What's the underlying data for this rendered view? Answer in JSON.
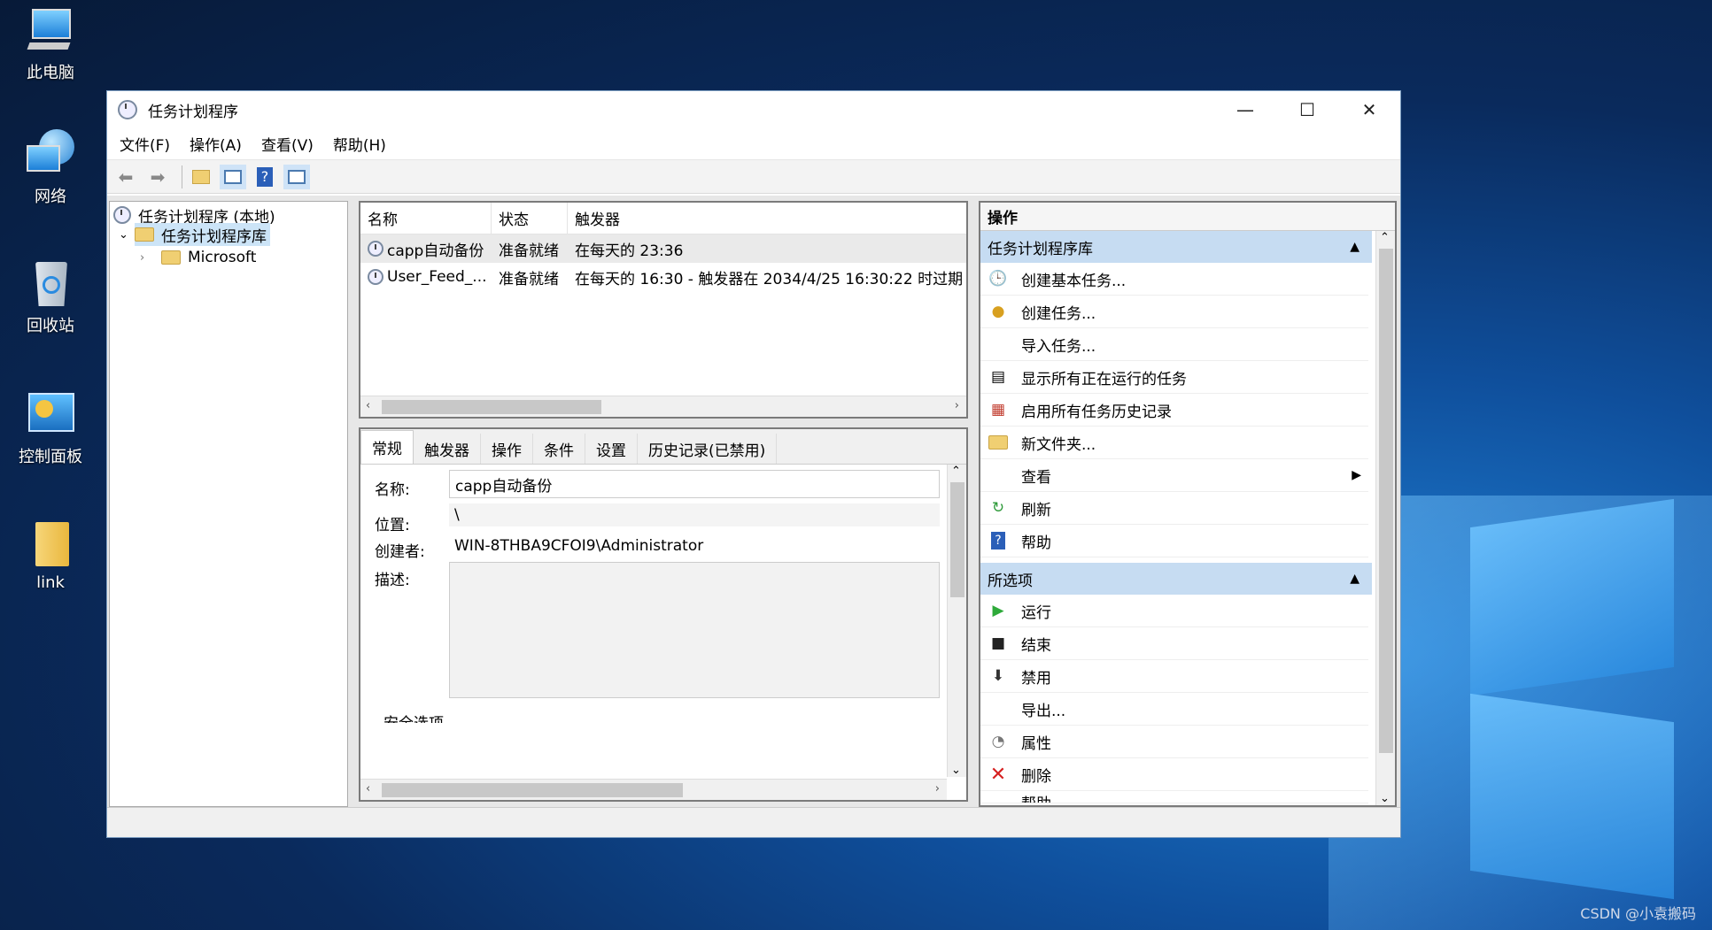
{
  "desktop": {
    "icons": [
      {
        "label": "此电脑",
        "icon": "computer-icon"
      },
      {
        "label": "网络",
        "icon": "network-icon"
      },
      {
        "label": "回收站",
        "icon": "recycle-bin-icon"
      },
      {
        "label": "控制面板",
        "icon": "control-panel-icon"
      },
      {
        "label": "link",
        "icon": "folder-icon"
      }
    ],
    "watermark": "CSDN @小袁搬码"
  },
  "window": {
    "title": "任务计划程序",
    "menu": [
      "文件(F)",
      "操作(A)",
      "查看(V)",
      "帮助(H)"
    ],
    "controls": {
      "minimize": "—",
      "maximize": "☐",
      "close": "✕"
    }
  },
  "toolbar": {
    "buttons": [
      "back-arrow-icon",
      "forward-arrow-icon",
      "folder-up-icon",
      "show-hide-tree-icon",
      "help-icon",
      "show-hide-action-pane-icon"
    ]
  },
  "tree": {
    "root": "任务计划程序 (本地)",
    "library": "任务计划程序库",
    "child": "Microsoft"
  },
  "task_list": {
    "columns": [
      "名称",
      "状态",
      "触发器"
    ],
    "rows": [
      {
        "name": "capp自动备份",
        "status": "准备就绪",
        "trigger": "在每天的 23:36"
      },
      {
        "name": "User_Feed_...",
        "status": "准备就绪",
        "trigger": "在每天的 16:30 - 触发器在 2034/4/25 16:30:22 时过期"
      }
    ],
    "selected_row": 0
  },
  "detail": {
    "tabs": [
      "常规",
      "触发器",
      "操作",
      "条件",
      "设置",
      "历史记录(已禁用)"
    ],
    "active_tab": 0,
    "name_label": "名称:",
    "name_value": "capp自动备份",
    "location_label": "位置:",
    "location_value": "\\",
    "author_label": "创建者:",
    "author_value": "WIN-8THBA9CFOI9\\Administrator",
    "description_label": "描述:",
    "description_value": "",
    "security_label": "安全选项"
  },
  "actions": {
    "header": "操作",
    "section1": {
      "title": "任务计划程序库",
      "items": [
        {
          "label": "创建基本任务...",
          "icon": "create-basic-task-icon"
        },
        {
          "label": "创建任务...",
          "icon": "create-task-icon"
        },
        {
          "label": "导入任务...",
          "icon": ""
        },
        {
          "label": "显示所有正在运行的任务",
          "icon": "running-tasks-icon"
        },
        {
          "label": "启用所有任务历史记录",
          "icon": "history-icon"
        },
        {
          "label": "新文件夹...",
          "icon": "new-folder-icon"
        },
        {
          "label": "查看",
          "icon": "",
          "submenu": true
        },
        {
          "label": "刷新",
          "icon": "refresh-icon"
        },
        {
          "label": "帮助",
          "icon": "help-icon"
        }
      ]
    },
    "section2": {
      "title": "所选项",
      "items": [
        {
          "label": "运行",
          "icon": "run-icon"
        },
        {
          "label": "结束",
          "icon": "stop-icon"
        },
        {
          "label": "禁用",
          "icon": "disable-icon"
        },
        {
          "label": "导出...",
          "icon": ""
        },
        {
          "label": "属性",
          "icon": "properties-icon"
        },
        {
          "label": "删除",
          "icon": "delete-icon"
        },
        {
          "label": "帮助",
          "icon": "help-icon"
        }
      ]
    }
  }
}
